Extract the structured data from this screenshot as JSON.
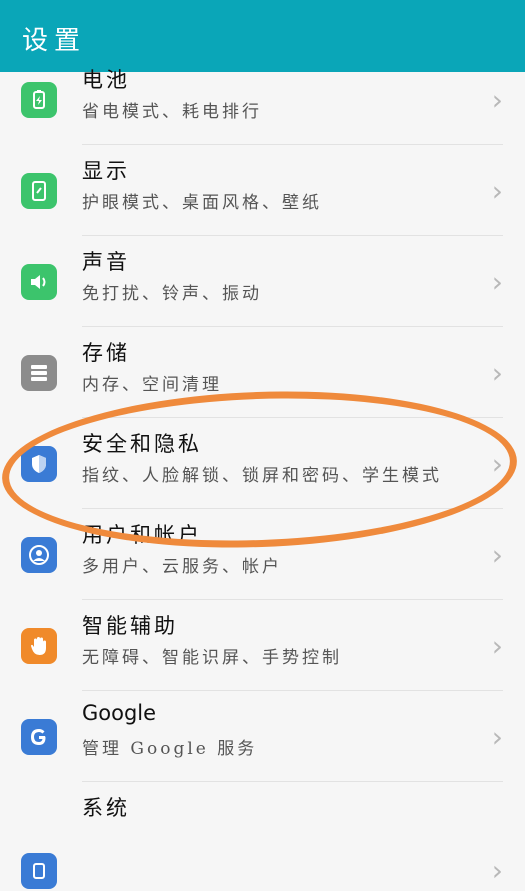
{
  "header": {
    "title": "设置"
  },
  "settings": {
    "items": [
      {
        "title": "电池",
        "subtitle": "省电模式、耗电排行",
        "icon": "battery-icon",
        "color": "#3cc46c"
      },
      {
        "title": "显示",
        "subtitle": "护眼模式、桌面风格、壁纸",
        "icon": "display-icon",
        "color": "#3cc46c"
      },
      {
        "title": "声音",
        "subtitle": "免打扰、铃声、振动",
        "icon": "sound-icon",
        "color": "#3cc46c"
      },
      {
        "title": "存储",
        "subtitle": "内存、空间清理",
        "icon": "storage-icon",
        "color": "#8c8c8c"
      },
      {
        "title": "安全和隐私",
        "subtitle": "指纹、人脸解锁、锁屏和密码、学生模式",
        "icon": "shield-icon",
        "color": "#3a7bd5"
      },
      {
        "title": "用户和帐户",
        "subtitle": "多用户、云服务、帐户",
        "icon": "user-icon",
        "color": "#3a7bd5"
      },
      {
        "title": "智能辅助",
        "subtitle": "无障碍、智能识屏、手势控制",
        "icon": "hand-icon",
        "color": "#f08a2a"
      },
      {
        "title": "Google",
        "subtitle": "管理 Google 服务",
        "icon": "google-icon",
        "color": "#3a7bd5"
      },
      {
        "title": "系统",
        "subtitle": "",
        "icon": "system-icon",
        "color": "#3a7bd5"
      }
    ]
  }
}
